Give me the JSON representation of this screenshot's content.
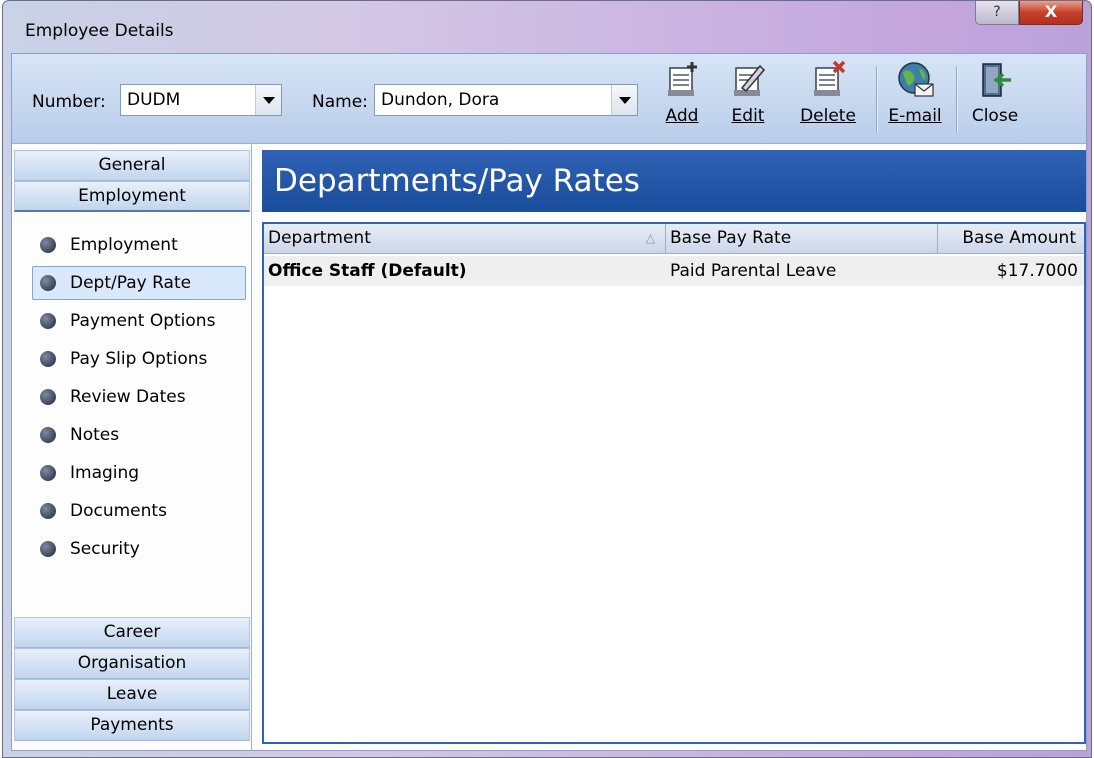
{
  "window": {
    "title": "Employee Details",
    "help_glyph": "?",
    "close_glyph": "X"
  },
  "toolbar": {
    "number_label": "Number:",
    "number_value": "DUDM",
    "name_label": "Name:",
    "name_value": "Dundon, Dora",
    "buttons": [
      {
        "label": "Add",
        "icon": "add-document-icon"
      },
      {
        "label": "Edit",
        "icon": "edit-document-icon"
      },
      {
        "label": "Delete",
        "icon": "delete-document-icon"
      },
      {
        "label": "E-mail",
        "icon": "email-globe-icon"
      },
      {
        "label": "Close",
        "icon": "exit-door-icon"
      }
    ]
  },
  "nav": {
    "top_groups": [
      "General",
      "Employment"
    ],
    "active_group": "Employment",
    "items": [
      "Employment",
      "Dept/Pay Rate",
      "Payment Options",
      "Pay Slip Options",
      "Review Dates",
      "Notes",
      "Imaging",
      "Documents",
      "Security"
    ],
    "selected_item": "Dept/Pay Rate",
    "bottom_groups": [
      "Career",
      "Organisation",
      "Leave",
      "Payments"
    ]
  },
  "panel": {
    "title": "Departments/Pay Rates"
  },
  "grid": {
    "columns": [
      "Department",
      "Base Pay Rate",
      "Base Amount"
    ],
    "sort_indicator": "△",
    "rows": [
      [
        "Office Staff (Default)",
        "Paid Parental Leave",
        "$17.7000"
      ]
    ]
  },
  "colors": {
    "header_blue": "#1f52a3",
    "close_red": "#c6402b",
    "selection": "#d9e8fb"
  }
}
